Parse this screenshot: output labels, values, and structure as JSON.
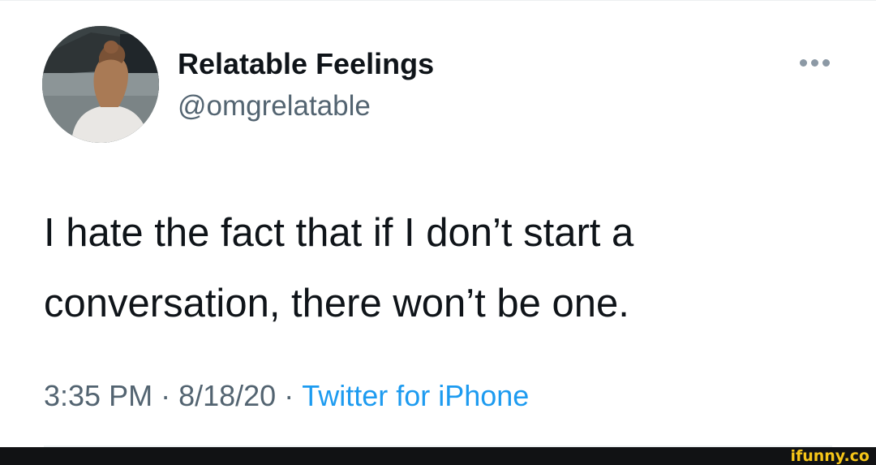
{
  "tweet": {
    "author_name": "Relatable Feelings",
    "author_handle": "@omgrelatable",
    "more_options": "···",
    "text_lines": [
      "I hate the fact that if I don’t start a",
      "conversation, there won’t be one."
    ],
    "time": "3:35 PM",
    "date": "8/18/20",
    "separator": "·",
    "source": "Twitter for iPhone"
  },
  "watermark": {
    "text": "ifunny.co"
  },
  "colors": {
    "text_primary": "#0f1419",
    "text_secondary": "#536471",
    "link_blue": "#1d9bf0",
    "watermark_yellow": "#f5c518",
    "watermark_bar": "#111214"
  },
  "icons": {
    "more": "more-horizontal-icon"
  }
}
